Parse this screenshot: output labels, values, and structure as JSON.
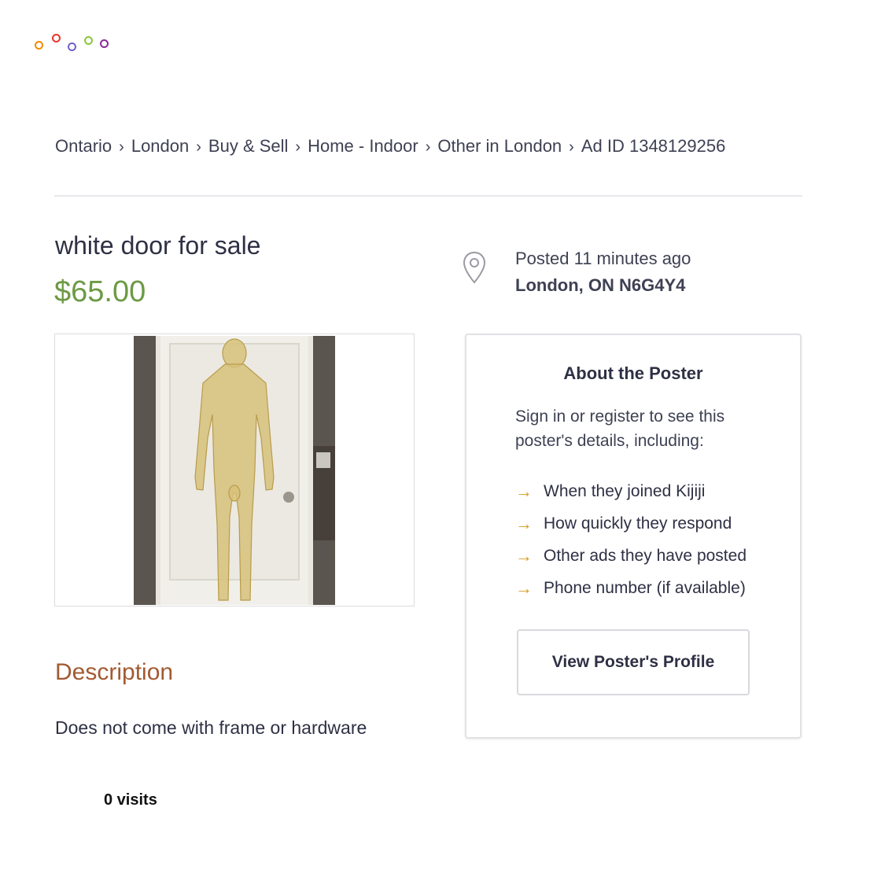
{
  "logo": {
    "name": "kijiji-logo",
    "ring_colors": [
      "#f28c00",
      "#e8352a",
      "#6f62c9",
      "#8cc63f",
      "#8a2a9a"
    ]
  },
  "breadcrumb": [
    "Ontario",
    "London",
    "Buy & Sell",
    "Home - Indoor",
    "Other in London",
    "Ad ID 1348129256"
  ],
  "breadcrumb_separator": "›",
  "ad": {
    "title": "white door for sale",
    "price": "$65.00",
    "posted": "Posted 11 minutes ago",
    "location": "London, ON N6G4Y4"
  },
  "poster": {
    "heading": "About the Poster",
    "intro": "Sign in or register to see this poster's details, including:",
    "items": [
      "When they joined Kijiji",
      "How quickly they respond",
      "Other ads they have posted",
      "Phone number (if available)"
    ],
    "arrow_icon": "arrow-right-icon",
    "button_label": "View Poster's Profile"
  },
  "description": {
    "heading": "Description",
    "text": "Does not come with frame or hardware"
  },
  "visits": "0 visits",
  "colors": {
    "price": "#6c9a44",
    "description_heading": "#a35a32",
    "arrow": "#d99a1e",
    "text": "#2e3044"
  }
}
